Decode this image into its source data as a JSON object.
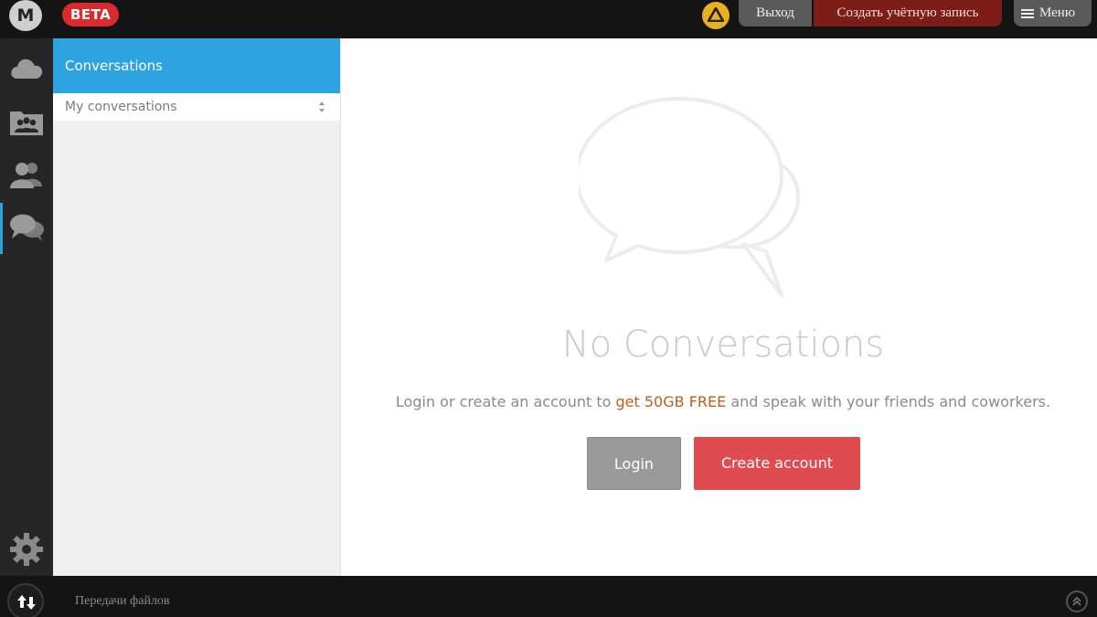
{
  "topbar": {
    "logo_text": "M",
    "beta_label": "BETA",
    "exit_label": "Выход",
    "create_account_label": "Создать учётную запись",
    "menu_label": "Меню"
  },
  "rail": {
    "items": [
      {
        "icon": "cloud-drive-icon"
      },
      {
        "icon": "shared-folders-icon"
      },
      {
        "icon": "contacts-icon"
      },
      {
        "icon": "conversations-icon",
        "active": true
      },
      {
        "icon": "settings-gear-icon"
      }
    ]
  },
  "panel": {
    "title": "Conversations",
    "filter_value": "My conversations"
  },
  "main": {
    "empty_title": "No Conversations",
    "empty_text_prefix": "Login or create an account to ",
    "empty_text_highlight": "get 50GB FREE",
    "empty_text_suffix": " and speak with your friends and coworkers.",
    "login_label": "Login",
    "create_account_label": "Create account"
  },
  "bottombar": {
    "transfers_label": "Передачи файлов"
  },
  "colors": {
    "accent": "#2ea3e1",
    "beta_red": "#d92b2b",
    "create_red": "#e04b4f",
    "highlight_orange": "#c45a1d",
    "warning_yellow": "#e6b022"
  }
}
